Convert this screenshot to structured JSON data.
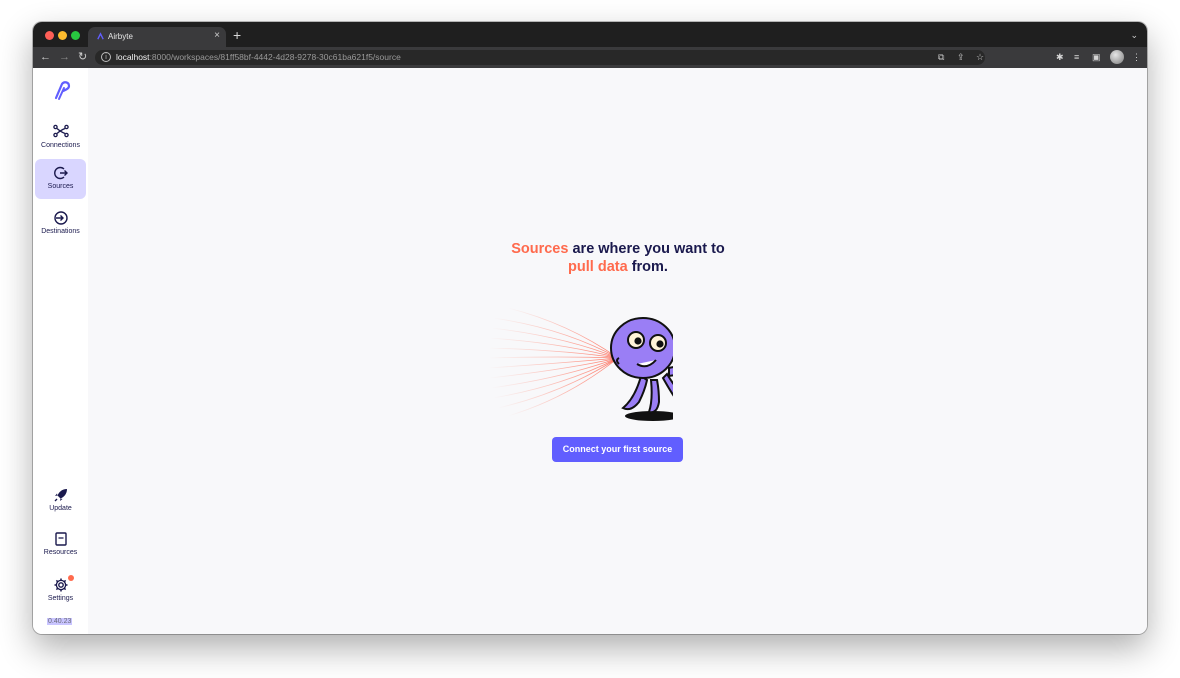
{
  "browser": {
    "tab_title": "Airbyte",
    "tab_close": "×",
    "new_tab": "+",
    "url_host": "localhost",
    "url_path": ":8000/workspaces/81ff58bf-4442-4d28-9278-30c61ba621f5/source"
  },
  "sidebar": {
    "items": [
      {
        "label": "Connections",
        "icon": "connections-icon"
      },
      {
        "label": "Sources",
        "icon": "sources-icon",
        "active": true
      },
      {
        "label": "Destinations",
        "icon": "destinations-icon"
      }
    ],
    "bottom_items": [
      {
        "label": "Update",
        "icon": "rocket-icon"
      },
      {
        "label": "Resources",
        "icon": "book-icon"
      },
      {
        "label": "Settings",
        "icon": "gear-icon",
        "notification": true
      }
    ],
    "version": "0.40.23"
  },
  "main": {
    "headline_accent_1": "Sources",
    "headline_rest_1": " are where you want to",
    "headline_accent_2": "pull data",
    "headline_rest_2": " from.",
    "cta_label": "Connect your first source"
  },
  "colors": {
    "accent_orange": "#ff6a4d",
    "primary_blue": "#615eff",
    "active_nav_bg": "#d9d6ff",
    "text_dark": "#1a194d",
    "octopus_purple": "#9a7ef5"
  }
}
